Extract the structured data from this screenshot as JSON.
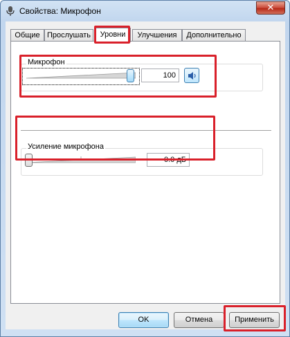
{
  "window": {
    "title": "Свойства: Микрофон",
    "close_glyph": "✕"
  },
  "tabs": [
    {
      "label": "Общие"
    },
    {
      "label": "Прослушать"
    },
    {
      "label": "Уровни",
      "active": true
    },
    {
      "label": "Улучшения"
    },
    {
      "label": "Дополнительно"
    }
  ],
  "levels": {
    "microphone": {
      "label": "Микрофон",
      "value": "100",
      "level_fraction": 1.0,
      "mute_icon": "speaker-icon"
    },
    "boost": {
      "label": "Усиление микрофона",
      "value": "0.0 дБ",
      "level_fraction": 0.0
    }
  },
  "buttons": {
    "ok": "OK",
    "cancel": "Отмена",
    "apply": "Применить"
  },
  "colors": {
    "highlight": "#d9202a",
    "accent": "#3c7fb1"
  }
}
